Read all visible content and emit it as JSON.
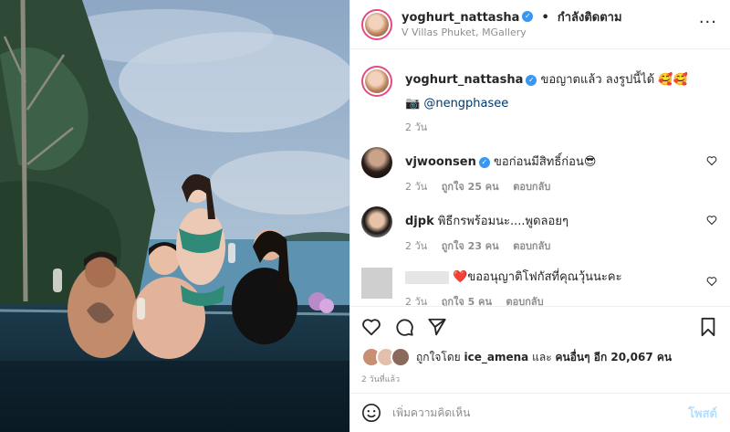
{
  "header": {
    "username": "yoghurt_nattasha",
    "separator": "•",
    "follow_status": "กำลังติดตาม",
    "location": "V Villas Phuket, MGallery",
    "more": "···"
  },
  "caption": {
    "username": "yoghurt_nattasha",
    "text": "ขอญาตแล้ว ลงรูปนี้ได้",
    "emoji": "🥰🥰",
    "camera": "📷",
    "tag": "@nengphasee",
    "time": "2 วัน"
  },
  "comments": [
    {
      "username": "vjwoonsen",
      "verified": true,
      "text": "ขอก่อนมีสิทธิ์ก่อน😎",
      "time": "2 วัน",
      "likes": "ถูกใจ 25 คน",
      "reply": "ตอบกลับ"
    },
    {
      "username": "djpk",
      "verified": false,
      "text": "พิธีกรพร้อมนะ....พูดลอยๆ",
      "time": "2 วัน",
      "likes": "ถูกใจ 23 คน",
      "reply": "ตอบกลับ"
    },
    {
      "username": "",
      "verified": false,
      "text": "❤️ขออนุญาติโฟกัสที่คุณวุ้นนะคะ",
      "time": "2 วัน",
      "likes": "ถูกใจ 5 คน",
      "reply": "ตอบกลับ"
    }
  ],
  "likes": {
    "prefix": "ถูกใจโดย",
    "user": "ice_amena",
    "middle": "และ",
    "others": "คนอื่นๆ อีก 20,067 คน"
  },
  "timestamp": "2 วันที่แล้ว",
  "add_comment": {
    "emoji_icon": "smile-icon",
    "placeholder": "เพิ่มความคิดเห็น",
    "post": "โพสต์"
  },
  "colors": {
    "accent": "#3897f0",
    "post_disabled": "#b2dffc",
    "heart": "#ed4956"
  }
}
